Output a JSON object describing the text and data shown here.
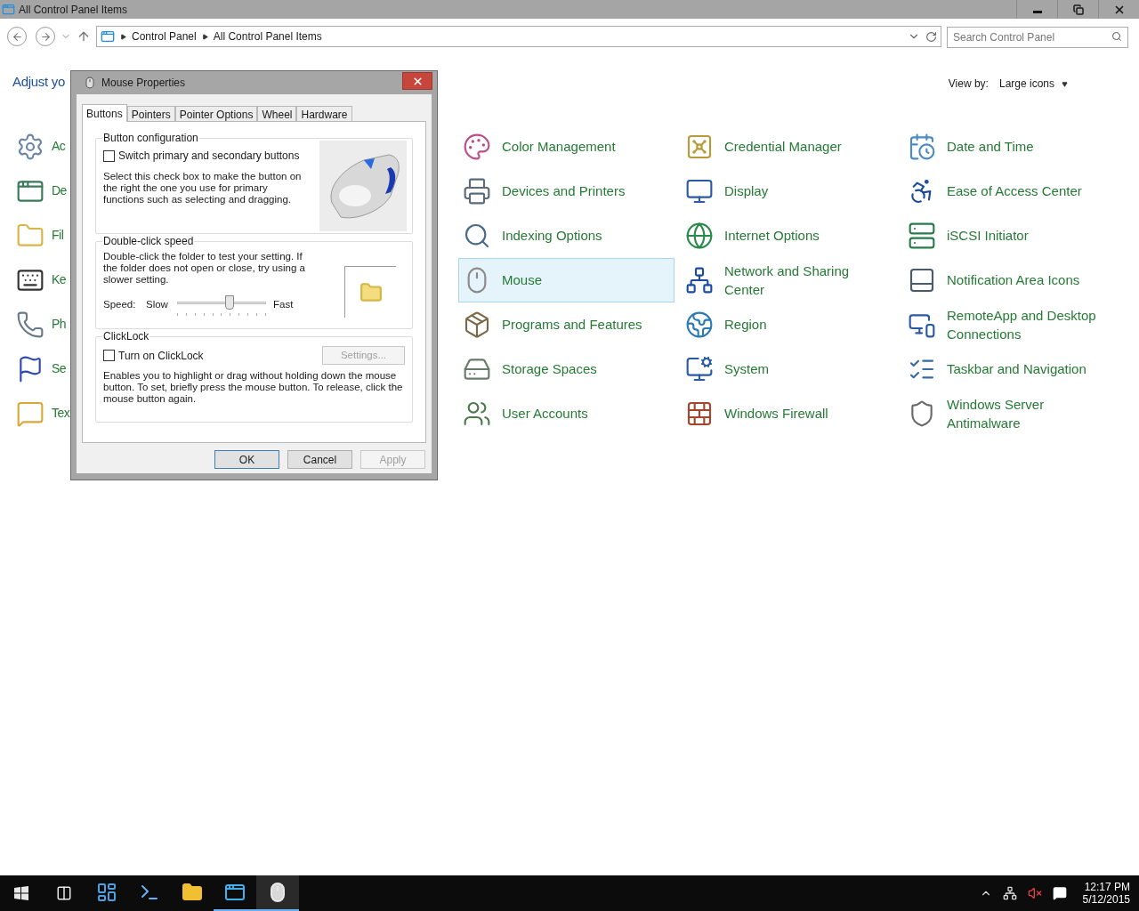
{
  "window": {
    "title": "All Control Panel Items"
  },
  "address": {
    "crumbs": [
      "Control Panel",
      "All Control Panel Items"
    ],
    "search": {
      "placeholder": "Search Control Panel"
    }
  },
  "heading": "Adjust yo",
  "view_by": {
    "label": "View by:",
    "value": "Large icons"
  },
  "left_column": [
    {
      "label": "Ac",
      "kind": "gear"
    },
    {
      "label": "De",
      "kind": "window"
    },
    {
      "label": "Fil",
      "kind": "folder"
    },
    {
      "label": "Ke",
      "kind": "keyboard"
    },
    {
      "label": "Ph",
      "kind": "phone"
    },
    {
      "label": "Se",
      "kind": "flag"
    },
    {
      "label": "Tex",
      "kind": "speech"
    }
  ],
  "grid_columns": [
    [
      {
        "label": "Color Management",
        "kind": "palette",
        "selected": false
      },
      {
        "label": "Devices and Printers",
        "kind": "printer",
        "selected": false
      },
      {
        "label": "Indexing Options",
        "kind": "search",
        "selected": false
      },
      {
        "label": "Mouse",
        "kind": "mouse",
        "selected": true
      },
      {
        "label": "Programs and Features",
        "kind": "package",
        "selected": false
      },
      {
        "label": "Storage Spaces",
        "kind": "drive",
        "selected": false
      },
      {
        "label": "User Accounts",
        "kind": "users",
        "selected": false
      }
    ],
    [
      {
        "label": "Credential Manager",
        "kind": "vault",
        "selected": false
      },
      {
        "label": "Display",
        "kind": "monitor",
        "selected": false
      },
      {
        "label": "Internet Options",
        "kind": "globe",
        "selected": false
      },
      {
        "label": "Network and Sharing Center",
        "kind": "network",
        "selected": false
      },
      {
        "label": "Region",
        "kind": "earth",
        "selected": false
      },
      {
        "label": "System",
        "kind": "system",
        "selected": false
      },
      {
        "label": "Windows Firewall",
        "kind": "wall",
        "selected": false
      }
    ],
    [
      {
        "label": "Date and Time",
        "kind": "calendar",
        "selected": false
      },
      {
        "label": "Ease of Access Center",
        "kind": "access",
        "selected": false
      },
      {
        "label": "iSCSI Initiator",
        "kind": "server",
        "selected": false
      },
      {
        "label": "Notification Area Icons",
        "kind": "panel",
        "selected": false
      },
      {
        "label": "RemoteApp and Desktop Connections",
        "kind": "remote",
        "selected": false
      },
      {
        "label": "Taskbar and Navigation",
        "kind": "list",
        "selected": false
      },
      {
        "label": "Windows Server Antimalware",
        "kind": "shield",
        "selected": false
      }
    ]
  ],
  "dialog": {
    "title": "Mouse Properties",
    "tabs": [
      {
        "label": "Buttons",
        "selected": true
      },
      {
        "label": "Pointers",
        "selected": false
      },
      {
        "label": "Pointer Options",
        "selected": false
      },
      {
        "label": "Wheel",
        "selected": false
      },
      {
        "label": "Hardware",
        "selected": false
      }
    ],
    "button_configuration": {
      "title": "Button configuration",
      "checkbox": {
        "label": "Switch primary and secondary buttons",
        "checked": false
      },
      "description": "Select this check box to make the button on the right the one you use for primary functions such as selecting and dragging."
    },
    "double_click_speed": {
      "title": "Double-click speed",
      "description": "Double-click the folder to test your setting. If the folder does not open or close, try using a slower setting.",
      "speed_label": "Speed:",
      "slow": "Slow",
      "fast": "Fast",
      "level": 0.59
    },
    "clicklock": {
      "title": "ClickLock",
      "checkbox": {
        "label": "Turn on ClickLock",
        "checked": false
      },
      "settings": {
        "label": "Settings...",
        "disabled": true
      },
      "description": "Enables you to highlight or drag without holding down the mouse button. To set, briefly press the mouse button. To release, click the mouse button again."
    },
    "buttons": [
      {
        "label": "OK",
        "disabled": false,
        "default": true
      },
      {
        "label": "Cancel",
        "disabled": false,
        "default": false
      },
      {
        "label": "Apply",
        "disabled": true,
        "default": false
      }
    ]
  },
  "taskbar": {
    "apps": [
      {
        "kind": "server",
        "running": false,
        "selected": false
      },
      {
        "kind": "shell",
        "running": false,
        "selected": false
      },
      {
        "kind": "explorer",
        "running": false,
        "selected": false
      },
      {
        "kind": "control",
        "running": true,
        "selected": false
      },
      {
        "kind": "mouse",
        "running": true,
        "selected": true
      }
    ],
    "time": "12:17 PM",
    "date": "5/12/2015"
  }
}
